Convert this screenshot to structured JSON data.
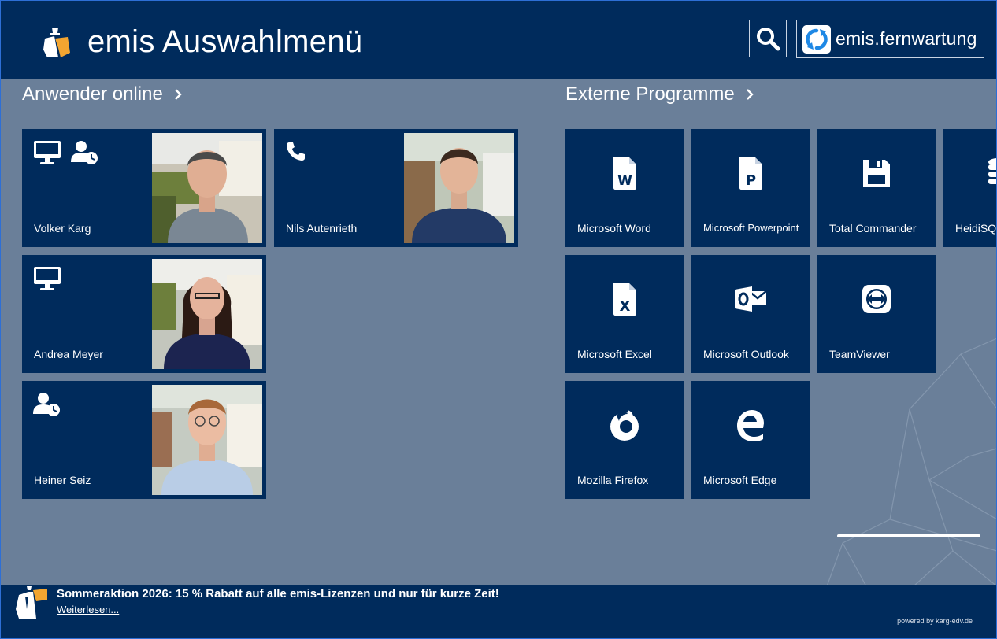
{
  "header": {
    "title": "emis Auswahlmenü",
    "search_icon": "search-icon",
    "remote_button_label": "emis.fernwartung",
    "remote_icon": "sync-logo-icon"
  },
  "users_section": {
    "title": "Anwender online",
    "users": [
      {
        "name": "Volker Karg",
        "status_icons": [
          "monitor-icon",
          "user-clock-icon"
        ]
      },
      {
        "name": "Nils Autenrieth",
        "status_icons": [
          "phone-icon"
        ]
      },
      {
        "name": "Andrea Meyer",
        "status_icons": [
          "monitor-icon"
        ]
      },
      {
        "name": "Heiner Seiz",
        "status_icons": [
          "user-clock-icon"
        ]
      }
    ]
  },
  "programs_section": {
    "title": "Externe Programme",
    "programs": [
      {
        "name": "Microsoft Word",
        "icon": "word-file-icon"
      },
      {
        "name": "Microsoft Powerpoint",
        "icon": "powerpoint-file-icon"
      },
      {
        "name": "Total Commander",
        "icon": "floppy-disk-icon"
      },
      {
        "name": "HeidiSQL",
        "icon": "database-icon"
      },
      {
        "name": "Microsoft Excel",
        "icon": "excel-file-icon"
      },
      {
        "name": "Microsoft Outlook",
        "icon": "outlook-icon"
      },
      {
        "name": "TeamViewer",
        "icon": "teamviewer-icon"
      },
      {
        "name": "Mozilla Firefox",
        "icon": "firefox-icon"
      },
      {
        "name": "Microsoft Edge",
        "icon": "edge-icon"
      }
    ]
  },
  "footer": {
    "promo_text": "Sommeraktion 2026: 15 % Rabatt auf alle emis-Lizenzen und nur für kurze Zeit!",
    "promo_link": "Weiterlesen...",
    "powered_by": "powered by karg-edv.de"
  },
  "colors": {
    "primary": "#002b5c",
    "background": "#6a7f99",
    "logo_accent": "#f2a531"
  }
}
